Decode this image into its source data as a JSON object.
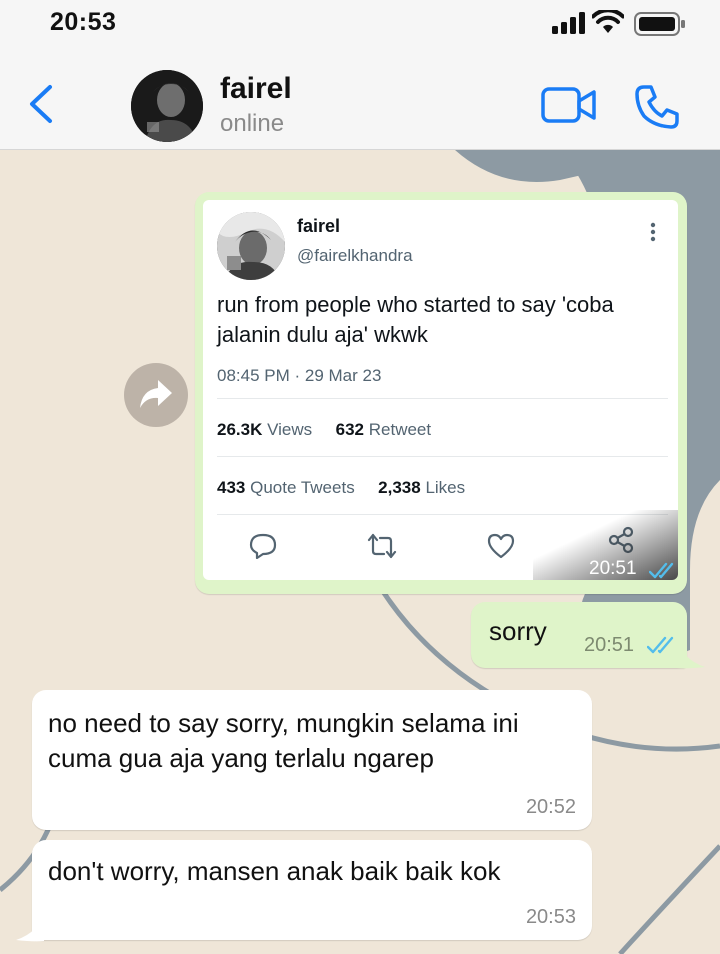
{
  "status_bar": {
    "time": "20:53"
  },
  "header": {
    "back_icon": "chevron-left-icon",
    "contact_name": "fairel",
    "contact_status": "online",
    "video_icon": "video-call-icon",
    "call_icon": "phone-icon"
  },
  "colors": {
    "accent": "#1a7cf5",
    "sent_bubble": "#dff4c9",
    "received_bubble": "#ffffff",
    "read_ticks": "#53bdeb",
    "wallpaper": "#efe6d8"
  },
  "messages": {
    "tweet_share": {
      "author_name": "fairel",
      "author_handle": "@fairelkhandra",
      "text": "run from people who started to say 'coba jalanin dulu aja' wkwk",
      "posted_at": "08:45 PM · 29 Mar 23",
      "views_count": "26.3K",
      "views_label": "Views",
      "retweet_count": "632",
      "retweet_label": "Retweet",
      "quote_count": "433",
      "quote_label": "Quote Tweets",
      "likes_count": "2,338",
      "likes_label": "Likes",
      "time": "20:51"
    },
    "sent": {
      "text": "sorry",
      "time": "20:51"
    },
    "received": [
      {
        "text": "no need to say sorry, mungkin selama ini cuma gua aja yang terlalu ngarep",
        "time": "20:52"
      },
      {
        "text": "don't worry, mansen anak baik baik kok",
        "time": "20:53"
      }
    ]
  }
}
